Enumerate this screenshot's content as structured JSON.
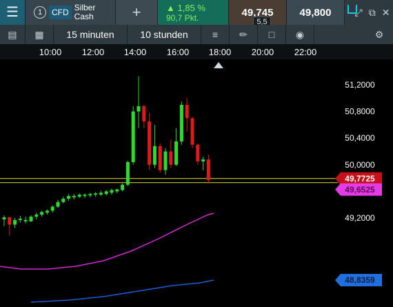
{
  "header": {
    "instrument_number": "1",
    "instrument_type": "CFD",
    "instrument_name_line1": "Silber",
    "instrument_name_line2": "Cash",
    "add_label": "+",
    "change_pct": "1,85 %",
    "change_pts": "90,7 Pkt.",
    "sell_price": "49,745",
    "buy_price": "49,800",
    "spread": "5,5"
  },
  "toolbar": {
    "interval": "15 minuten",
    "range": "10 stunden"
  },
  "chart": {
    "time_labels": [
      "10:00",
      "12:00",
      "14:00",
      "16:00",
      "18:00",
      "20:00",
      "22:00"
    ],
    "price_labels": [
      "51,2000",
      "50,8000",
      "50,4000",
      "50,0000",
      "49,2000"
    ],
    "current_price": "49,7725",
    "magenta_ma": "49,6525",
    "blue_ma": "48,8359",
    "colors": {
      "up": "#2bdc2b",
      "down": "#e01919",
      "current_line": "#e0e030",
      "magenta": "#d22bd2",
      "blue": "#1a5fd6"
    }
  },
  "chart_data": {
    "type": "candlestick",
    "series": [
      {
        "o": 49.18,
        "h": 49.24,
        "l": 49.08,
        "c": 49.21
      },
      {
        "o": 49.21,
        "h": 49.22,
        "l": 48.94,
        "c": 49.1
      },
      {
        "o": 49.1,
        "h": 49.2,
        "l": 49.05,
        "c": 49.17
      },
      {
        "o": 49.17,
        "h": 49.23,
        "l": 49.13,
        "c": 49.19
      },
      {
        "o": 49.15,
        "h": 49.22,
        "l": 49.12,
        "c": 49.17
      },
      {
        "o": 49.15,
        "h": 49.24,
        "l": 49.14,
        "c": 49.22
      },
      {
        "o": 49.22,
        "h": 49.28,
        "l": 49.18,
        "c": 49.25
      },
      {
        "o": 49.25,
        "h": 49.31,
        "l": 49.22,
        "c": 49.29
      },
      {
        "o": 49.28,
        "h": 49.33,
        "l": 49.25,
        "c": 49.31
      },
      {
        "o": 49.31,
        "h": 49.39,
        "l": 49.28,
        "c": 49.37
      },
      {
        "o": 49.37,
        "h": 49.47,
        "l": 49.35,
        "c": 49.44
      },
      {
        "o": 49.44,
        "h": 49.52,
        "l": 49.42,
        "c": 49.49
      },
      {
        "o": 49.49,
        "h": 49.56,
        "l": 49.46,
        "c": 49.53
      },
      {
        "o": 49.51,
        "h": 49.56,
        "l": 49.48,
        "c": 49.53
      },
      {
        "o": 49.52,
        "h": 49.57,
        "l": 49.5,
        "c": 49.55
      },
      {
        "o": 49.53,
        "h": 49.57,
        "l": 49.5,
        "c": 49.55
      },
      {
        "o": 49.54,
        "h": 49.58,
        "l": 49.51,
        "c": 49.56
      },
      {
        "o": 49.55,
        "h": 49.59,
        "l": 49.52,
        "c": 49.57
      },
      {
        "o": 49.55,
        "h": 49.61,
        "l": 49.53,
        "c": 49.58
      },
      {
        "o": 49.56,
        "h": 49.62,
        "l": 49.54,
        "c": 49.6
      },
      {
        "o": 49.58,
        "h": 49.64,
        "l": 49.55,
        "c": 49.62
      },
      {
        "o": 49.6,
        "h": 49.64,
        "l": 49.57,
        "c": 49.63
      },
      {
        "o": 49.62,
        "h": 49.72,
        "l": 49.6,
        "c": 49.7
      },
      {
        "o": 49.7,
        "h": 50.06,
        "l": 49.68,
        "c": 50.04
      },
      {
        "o": 50.04,
        "h": 50.88,
        "l": 50.0,
        "c": 50.8
      },
      {
        "o": 50.8,
        "h": 51.33,
        "l": 50.55,
        "c": 50.88
      },
      {
        "o": 50.88,
        "h": 50.9,
        "l": 50.55,
        "c": 50.65
      },
      {
        "o": 50.65,
        "h": 50.78,
        "l": 49.92,
        "c": 50.0
      },
      {
        "o": 50.0,
        "h": 50.6,
        "l": 49.95,
        "c": 50.28
      },
      {
        "o": 50.28,
        "h": 50.32,
        "l": 49.88,
        "c": 49.92
      },
      {
        "o": 49.92,
        "h": 50.25,
        "l": 49.85,
        "c": 50.2
      },
      {
        "o": 50.2,
        "h": 50.38,
        "l": 49.95,
        "c": 50.0
      },
      {
        "o": 50.0,
        "h": 50.55,
        "l": 49.98,
        "c": 50.35
      },
      {
        "o": 50.35,
        "h": 50.95,
        "l": 50.3,
        "c": 50.9
      },
      {
        "o": 50.9,
        "h": 51.0,
        "l": 50.5,
        "c": 50.7
      },
      {
        "o": 50.7,
        "h": 50.72,
        "l": 50.25,
        "c": 50.3
      },
      {
        "o": 50.3,
        "h": 50.32,
        "l": 50.0,
        "c": 50.05
      },
      {
        "o": 50.05,
        "h": 50.12,
        "l": 49.92,
        "c": 50.08
      },
      {
        "o": 50.08,
        "h": 50.15,
        "l": 49.72,
        "c": 49.77
      }
    ]
  }
}
